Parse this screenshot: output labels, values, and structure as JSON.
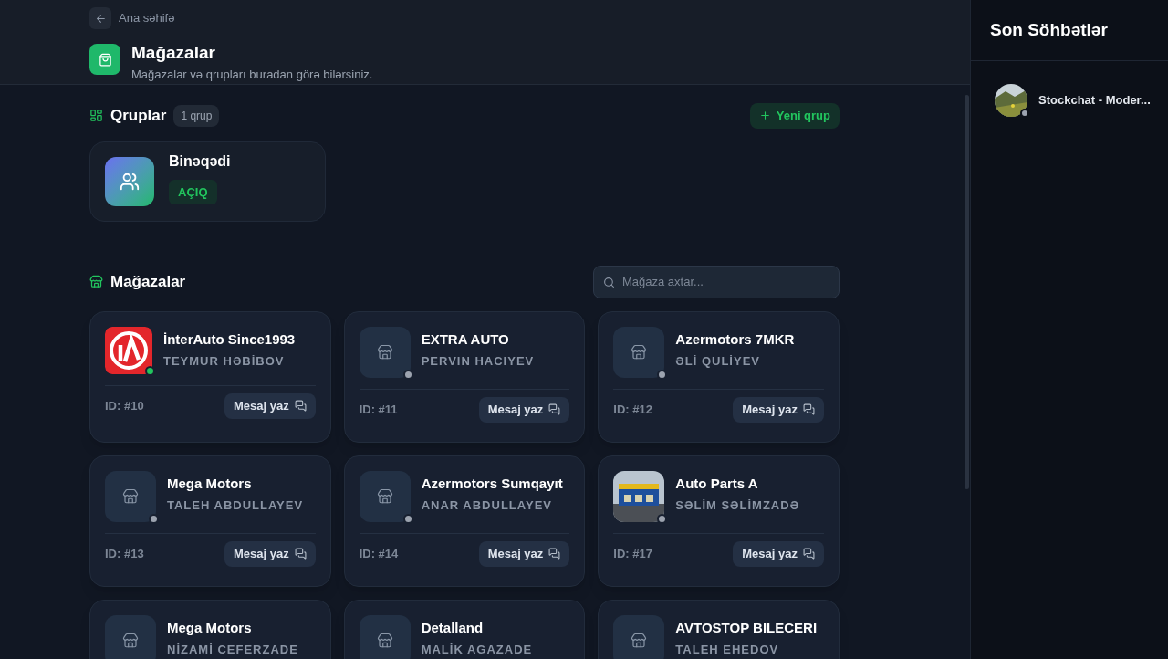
{
  "back_link": "Ana səhifə",
  "header": {
    "title": "Mağazalar",
    "subtitle": "Mağazalar və qrupları buradan görə bilərsiniz."
  },
  "groups": {
    "title": "Qruplar",
    "count": "1 qrup",
    "new_button": "Yeni qrup",
    "items": [
      {
        "name": "Binəqədi",
        "status": "AÇIQ"
      }
    ]
  },
  "stores": {
    "title": "Mağazalar",
    "search": {
      "placeholder": "Mağaza axtar..."
    },
    "items": [
      {
        "name": "İnterAuto Since1993",
        "owner": "TEYMUR HƏBİBOV",
        "id": "ID: #10",
        "action": "Mesaj yaz",
        "kind": "brand",
        "online": true
      },
      {
        "name": "EXTRA AUTO",
        "owner": "PERVIN HACIYEV",
        "id": "ID: #11",
        "action": "Mesaj yaz",
        "kind": "placeholder",
        "online": false
      },
      {
        "name": "Azermotors 7MKR",
        "owner": "ƏLİ QULİYEV",
        "id": "ID: #12",
        "action": "Mesaj yaz",
        "kind": "placeholder",
        "online": false
      },
      {
        "name": "Mega Motors",
        "owner": "TALEH ABDULLAYEV",
        "id": "ID: #13",
        "action": "Mesaj yaz",
        "kind": "placeholder",
        "online": false
      },
      {
        "name": "Azermotors Sumqayıt",
        "owner": "ANAR ABDULLAYEV",
        "id": "ID: #14",
        "action": "Mesaj yaz",
        "kind": "placeholder",
        "online": false
      },
      {
        "name": "Auto Parts A",
        "owner": "SƏLİM SƏLİMZADƏ",
        "id": "ID: #17",
        "action": "Mesaj yaz",
        "kind": "picture",
        "online": false
      },
      {
        "name": "Mega Motors",
        "owner": "NİZAMİ CEFERZADE",
        "kind": "placeholder"
      },
      {
        "name": "Detalland",
        "owner": "MALİK AGAZADE",
        "kind": "placeholder"
      },
      {
        "name": "AVTOSTOP BILECERI",
        "owner": "TALEH EHEDOV",
        "kind": "placeholder"
      }
    ]
  },
  "recent_chats": {
    "title": "Son Söhbətlər",
    "items": [
      {
        "name": "Stockchat - Moder...",
        "online": false
      }
    ]
  }
}
